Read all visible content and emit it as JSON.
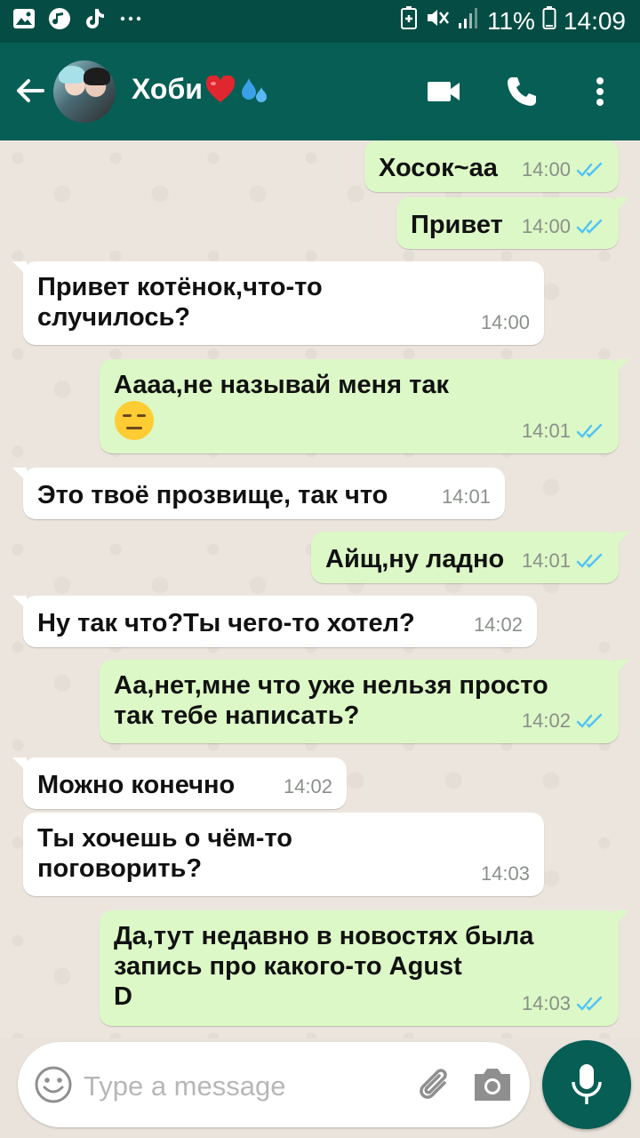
{
  "status_bar": {
    "battery_percent": "11%",
    "time": "14:09",
    "left_icons": [
      "gallery-icon",
      "music-icon",
      "tiktok-icon",
      "more-notifications-icon"
    ],
    "right_icons": [
      "battery-saver-icon",
      "mute-icon",
      "signal-icon",
      "battery-icon"
    ]
  },
  "header": {
    "contact_name": "Хоби",
    "name_emojis": [
      "red-heart",
      "sweat-droplets"
    ],
    "actions": [
      "video-call-icon",
      "phone-icon",
      "more-options-icon"
    ]
  },
  "messages": [
    {
      "id": 1,
      "direction": "out",
      "text": "Хосок~аа",
      "time": "14:00",
      "status": "read"
    },
    {
      "id": 2,
      "direction": "out",
      "text": "Привет",
      "time": "14:00",
      "status": "read"
    },
    {
      "id": 3,
      "direction": "in",
      "line1": "Привет котёнок,что-то",
      "line2": "случилось?",
      "time": "14:00"
    },
    {
      "id": 4,
      "direction": "out",
      "text": "Аааа,не называй меня так",
      "emoji": "expressionless-face",
      "time": "14:01",
      "status": "read"
    },
    {
      "id": 5,
      "direction": "in",
      "text": "Это твоё прозвище, так что",
      "time": "14:01"
    },
    {
      "id": 6,
      "direction": "out",
      "text": "Айщ,ну ладно",
      "time": "14:01",
      "status": "read"
    },
    {
      "id": 7,
      "direction": "in",
      "text": "Ну так что?Ты чего-то хотел?",
      "time": "14:02"
    },
    {
      "id": 8,
      "direction": "out",
      "line1": "Аа,нет,мне что уже нельзя просто",
      "line2": "так тебе написать?",
      "time": "14:02",
      "status": "read"
    },
    {
      "id": 9,
      "direction": "in",
      "text": "Можно конечно",
      "time": "14:02"
    },
    {
      "id": 10,
      "direction": "in",
      "line1": "Ты хочешь о чём-то",
      "line2": "поговорить?",
      "time": "14:03"
    },
    {
      "id": 11,
      "direction": "out",
      "line1": "Да,тут недавно в новостях была",
      "line2": "запись про какого-то Agust",
      "line3": "D",
      "time": "14:03",
      "status": "read"
    }
  ],
  "composer": {
    "placeholder": "Type a message",
    "icons": [
      "emoji-icon",
      "attach-icon",
      "camera-icon",
      "mic-icon"
    ]
  },
  "colors": {
    "appbar": "#075e54",
    "statusbar": "#054d44",
    "outgoing_bubble": "#dcf8c6",
    "incoming_bubble": "#ffffff",
    "read_check": "#4fc3f7",
    "chat_background": "#ece5dd"
  }
}
